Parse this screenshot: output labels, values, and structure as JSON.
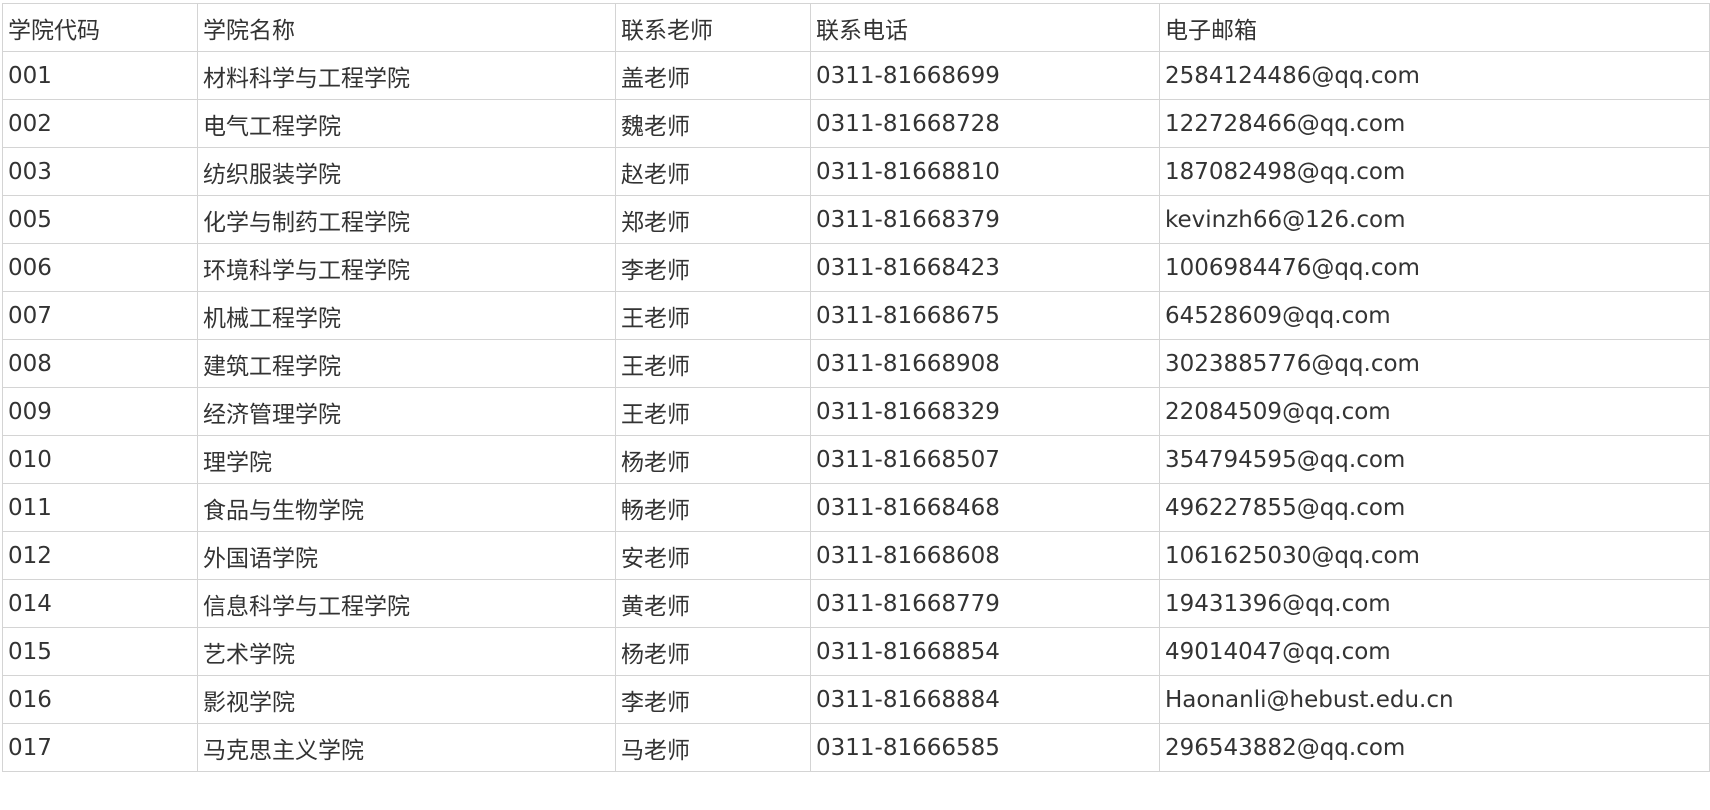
{
  "table": {
    "headers": [
      "学院代码",
      "学院名称",
      "联系老师",
      "联系电话",
      "电子邮箱"
    ],
    "rows": [
      [
        "001",
        "材料科学与工程学院",
        "盖老师",
        "0311-81668699",
        "2584124486@qq.com"
      ],
      [
        "002",
        "电气工程学院",
        "魏老师",
        "0311-81668728",
        "122728466@qq.com"
      ],
      [
        "003",
        "纺织服装学院",
        "赵老师",
        "0311-81668810",
        "187082498@qq.com"
      ],
      [
        "005",
        "化学与制药工程学院",
        "郑老师",
        "0311-81668379",
        "kevinzh66@126.com"
      ],
      [
        "006",
        "环境科学与工程学院",
        "李老师",
        "0311-81668423",
        "1006984476@qq.com"
      ],
      [
        "007",
        "机械工程学院",
        "王老师",
        "0311-81668675",
        "64528609@qq.com"
      ],
      [
        "008",
        "建筑工程学院",
        "王老师",
        "0311-81668908",
        "3023885776@qq.com"
      ],
      [
        "009",
        "经济管理学院",
        "王老师",
        "0311-81668329",
        "22084509@qq.com"
      ],
      [
        "010",
        "理学院",
        "杨老师",
        "0311-81668507",
        "354794595@qq.com"
      ],
      [
        "011",
        "食品与生物学院",
        "畅老师",
        "0311-81668468",
        "496227855@qq.com"
      ],
      [
        "012",
        "外国语学院",
        "安老师",
        "0311-81668608",
        "1061625030@qq.com"
      ],
      [
        "014",
        "信息科学与工程学院",
        "黄老师",
        "0311-81668779",
        "19431396@qq.com"
      ],
      [
        "015",
        "艺术学院",
        "杨老师",
        "0311-81668854",
        "49014047@qq.com"
      ],
      [
        "016",
        "影视学院",
        "李老师",
        "0311-81668884",
        "Haonanli@hebust.edu.cn"
      ],
      [
        "017",
        "马克思主义学院",
        "马老师",
        "0311-81666585",
        "296543882@qq.com"
      ]
    ]
  }
}
